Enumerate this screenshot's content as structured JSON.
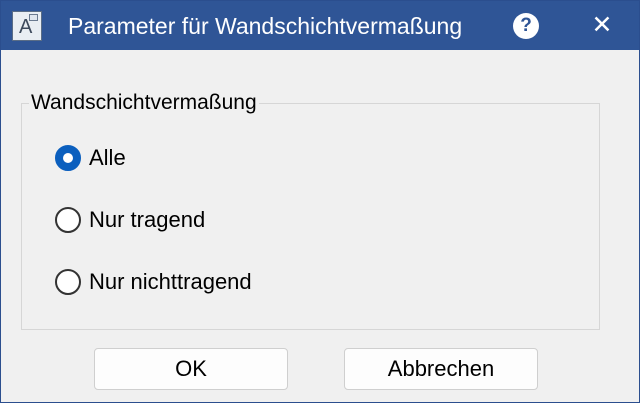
{
  "window": {
    "title": "Parameter für Wandschichtvermaßung",
    "app_icon_letter": "A",
    "help_glyph": "?",
    "close_glyph": "✕"
  },
  "group": {
    "label": "Wandschichtvermaßung",
    "options": [
      {
        "label": "Alle",
        "checked": true
      },
      {
        "label": "Nur tragend",
        "checked": false
      },
      {
        "label": "Nur nichttragend",
        "checked": false
      }
    ]
  },
  "buttons": {
    "ok_label": "OK",
    "cancel_label": "Abbrechen"
  },
  "colors": {
    "titlebar": "#2f5596",
    "accent": "#0b5fbe",
    "background": "#f0f0f0"
  },
  "icons": {
    "app": "app-icon",
    "help": "help-icon",
    "close": "close-icon"
  }
}
